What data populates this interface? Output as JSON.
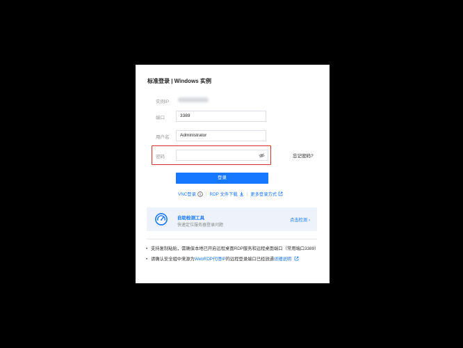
{
  "title": "标准登录 | Windows 实例",
  "fields": {
    "ip_label": "实例IP",
    "port_label": "端口",
    "port_value": "3389",
    "user_label": "用户名",
    "user_value": "Administrator",
    "password_label": "密码",
    "password_value": ""
  },
  "forgot_password": "忘记密码?",
  "login_button": "登录",
  "links": {
    "vnc": "VNC登录",
    "rdp": "RDP 文件下载",
    "more": "更多登录方式"
  },
  "tool": {
    "title": "自助检测工具",
    "subtitle": "快速定位服务器登录问题",
    "action": "点击检测",
    "icon": "check-gauge-icon"
  },
  "notes": {
    "note1": "支持复制粘贴，需确保本地已开启远程桌面RDP服务和远程桌面端口（常用端口3389）",
    "note2_prefix": "请确认安全组中来源为",
    "note2_link1": "WebRDP代理IP",
    "note2_middle": "的远程登录端口已经放通",
    "note2_link2": "详细说明"
  },
  "colors": {
    "accent": "#1677ff",
    "highlight": "#d53030",
    "tool_bg": "#eef3fb"
  }
}
